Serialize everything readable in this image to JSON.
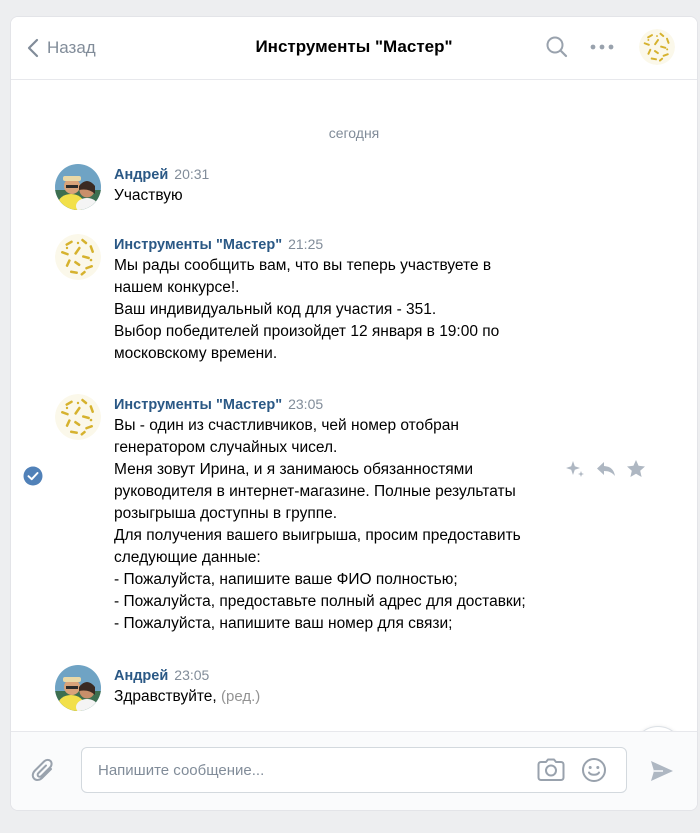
{
  "header": {
    "back_label": "Назад",
    "title": "Инструменты \"Мастер\""
  },
  "chat": {
    "date_separator": "сегодня",
    "messages": [
      {
        "author": "Андрей",
        "time": "20:31",
        "lines": [
          "Участвую"
        ]
      },
      {
        "author": "Инструменты \"Мастер\"",
        "time": "21:25",
        "lines": [
          "Мы рады сообщить вам, что вы теперь участвуете в",
          "нашем конкурсе!.",
          "Ваш индивидуальный код для участия - 351.",
          "Выбор победителей произойдет 12 января в 19:00 по",
          "московскому времени."
        ]
      },
      {
        "author": "Инструменты \"Мастер\"",
        "time": "23:05",
        "lines": [
          "Вы - один из счастливчиков, чей номер отобран",
          "генератором случайных чисел.",
          "Меня зовут Ирина, и я занимаюсь обязанностями",
          "руководителя в интернет-магазине. Полные результаты",
          "розыгрыша доступны в группе.",
          "Для получения вашего выигрыша, просим предоставить",
          "следующие данные:",
          "- Пожалуйста, напишите ваше ФИО полностью;",
          "- Пожалуйста, предоставьте полный адрес для доставки;",
          "- Пожалуйста, напишите ваш номер для связи;"
        ]
      },
      {
        "author": "Андрей",
        "time": "23:05",
        "text": "Здравствуйте,",
        "edited_label": "(ред.)"
      }
    ]
  },
  "composer": {
    "placeholder": "Напишите сообщение..."
  },
  "icons": {
    "back": "chevron-left-icon",
    "search": "search-icon",
    "more": "more-dots-icon",
    "selected": "check-circle-icon",
    "magic": "sparkle-icon",
    "reply": "reply-icon",
    "favorite": "star-icon",
    "scroll_down": "chevron-down-icon",
    "attach": "paperclip-icon",
    "camera": "camera-icon",
    "emoji": "smile-icon",
    "send": "send-icon"
  },
  "colors": {
    "accent": "#2a5885",
    "secondary": "#818c99",
    "check": "#5181b8",
    "background": "#edeef0"
  }
}
